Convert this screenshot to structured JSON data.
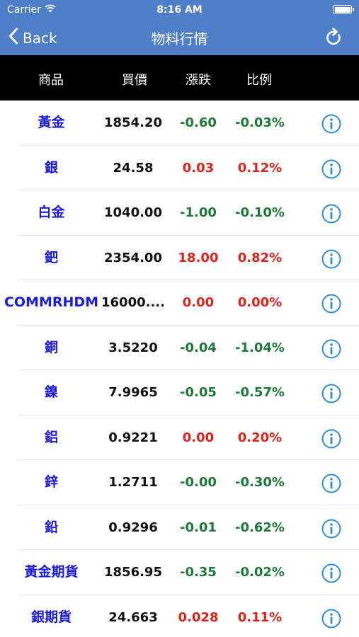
{
  "status_bar": {
    "carrier": "Carrier",
    "time": "8:16 AM"
  },
  "nav": {
    "back_label": "Back",
    "title": "物料行情"
  },
  "table": {
    "headers": [
      "商品",
      "買價",
      "漲跌",
      "比例"
    ],
    "rows": [
      {
        "name": "黃金",
        "price": "1854.20",
        "change": "-0.60",
        "percent": "-0.03%",
        "direction": "down"
      },
      {
        "name": "銀",
        "price": "24.58",
        "change": "0.03",
        "percent": "0.12%",
        "direction": "up"
      },
      {
        "name": "白金",
        "price": "1040.00",
        "change": "-1.00",
        "percent": "-0.10%",
        "direction": "down"
      },
      {
        "name": "鈀",
        "price": "2354.00",
        "change": "18.00",
        "percent": "0.82%",
        "direction": "up"
      },
      {
        "name": "COMMRHDM",
        "price": "16000....",
        "change": "0.00",
        "percent": "0.00%",
        "direction": "up"
      },
      {
        "name": "銅",
        "price": "3.5220",
        "change": "-0.04",
        "percent": "-1.04%",
        "direction": "down"
      },
      {
        "name": "鎳",
        "price": "7.9965",
        "change": "-0.05",
        "percent": "-0.57%",
        "direction": "down"
      },
      {
        "name": "鋁",
        "price": "0.9221",
        "change": "0.00",
        "percent": "0.20%",
        "direction": "up"
      },
      {
        "name": "鋅",
        "price": "1.2711",
        "change": "-0.00",
        "percent": "-0.30%",
        "direction": "mixed"
      },
      {
        "name": "鉛",
        "price": "0.9296",
        "change": "-0.01",
        "percent": "-0.62%",
        "direction": "down"
      },
      {
        "name": "黃金期貨",
        "price": "1856.95",
        "change": "-0.35",
        "percent": "-0.02%",
        "direction": "down"
      },
      {
        "name": "銀期貨",
        "price": "24.663",
        "change": "0.028",
        "percent": "0.11%",
        "direction": "up"
      }
    ]
  },
  "colors": {
    "nav_background": "#4f7fc9",
    "header_background": "#000000",
    "name_text": "#1a1ae6",
    "down": "#1a7a36",
    "up": "#e32119",
    "info_icon": "#2b8de0"
  },
  "icons": {
    "back": "chevron-left-icon",
    "refresh": "refresh-icon",
    "info": "info-icon",
    "wifi": "wifi-icon",
    "battery": "battery-icon"
  }
}
